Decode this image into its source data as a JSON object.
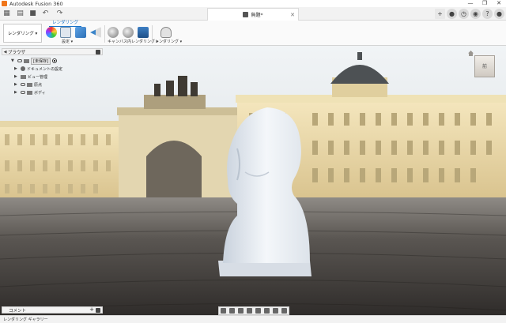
{
  "titlebar": {
    "title": "Autodesk Fusion 360",
    "minimize": "—",
    "maximize": "❐",
    "close": "✕"
  },
  "tab": {
    "label": "無題*",
    "close": "✕"
  },
  "quickaccess": {
    "grid": "▦",
    "file": "▤",
    "save": "■",
    "undo": "↶",
    "redo": "↷"
  },
  "topright": {
    "add": "+",
    "online": "●",
    "job": "◷",
    "notify": "◉",
    "help": "?",
    "avatar": "●"
  },
  "ribbon": {
    "active_tab": "レンダリング",
    "workspace": "レンダリング ▾",
    "groups": {
      "setup": "設定 ▾",
      "canvas_render": "キャンバス内レンダリング ▾",
      "render": "レンダリング ▾"
    }
  },
  "browser": {
    "title": "ブラウザ",
    "items": [
      {
        "label": "[未保存]",
        "type": "root"
      },
      {
        "label": "ドキュメントの設定",
        "type": "gear"
      },
      {
        "label": "ビュー管理",
        "type": "folder"
      },
      {
        "label": "原点",
        "type": "folder"
      },
      {
        "label": "ボディ",
        "type": "folder"
      }
    ]
  },
  "viewcube": {
    "label": "前"
  },
  "comments": {
    "title": "コメント",
    "add": "+"
  },
  "statusbar": {
    "text": "レンダリング ギャラリー"
  },
  "colors": {
    "accent": "#1a73c9",
    "sky": "#d6dde2",
    "building": "#e9d9a8",
    "pavement": "#4a4a4a",
    "bust": "#e9eef4"
  }
}
